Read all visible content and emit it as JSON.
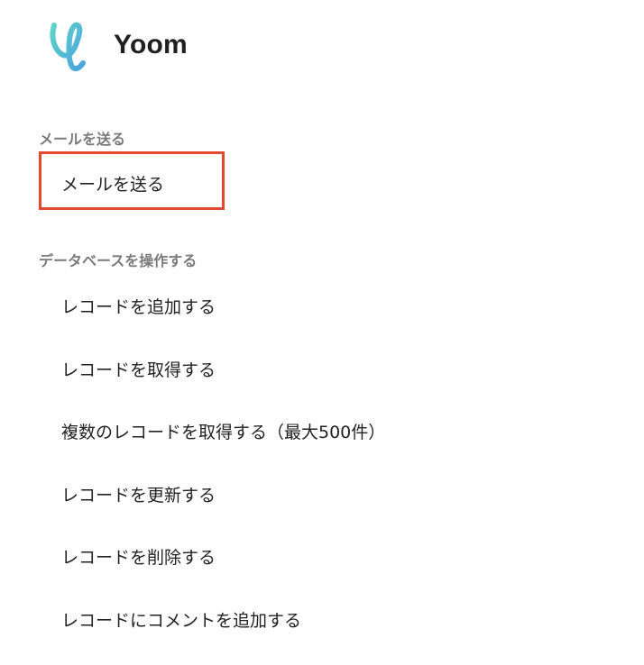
{
  "header": {
    "logo_icon": "yoom-logo-icon",
    "brand_name": "Yoom",
    "accent_color": "#5cc4d6"
  },
  "sections": [
    {
      "title": "メールを送る",
      "items": [
        {
          "label": "メールを送る",
          "selected": true
        }
      ]
    },
    {
      "title": "データベースを操作する",
      "items": [
        {
          "label": "レコードを追加する"
        },
        {
          "label": "レコードを取得する"
        },
        {
          "label": "複数のレコードを取得する（最大500件）"
        },
        {
          "label": "レコードを更新する"
        },
        {
          "label": "レコードを削除する"
        },
        {
          "label": "レコードにコメントを追加する"
        }
      ]
    }
  ],
  "highlight_color": "#e2492f"
}
